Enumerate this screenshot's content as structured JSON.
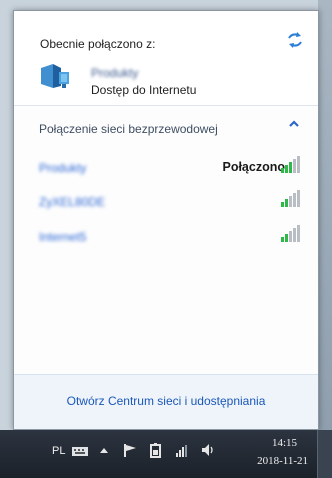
{
  "flyout": {
    "connected_title": "Obecnie połączono z:",
    "current_network": {
      "name": "Produkty",
      "access": "Dostęp do Internetu"
    },
    "wireless_header": "Połączenie sieci bezprzewodowej",
    "networks": [
      {
        "ssid": "Produkty",
        "status": "Połączono",
        "signal_bars": 5
      },
      {
        "ssid": "ZyXEL80DE",
        "status": "",
        "signal_bars": 5
      },
      {
        "ssid": "Internet5",
        "status": "",
        "signal_bars": 5
      }
    ],
    "footer_link": "Otwórz Centrum sieci i udostępniania"
  },
  "taskbar": {
    "language": "PL",
    "time": "14:15",
    "date": "2018-11-21"
  },
  "colors": {
    "signal_green": "#2fb84a",
    "signal_gray": "#b9bec4",
    "link_blue": "#1b57b8",
    "accent_blue": "#2b7fd6"
  },
  "icons": [
    "refresh-icon",
    "network-icon",
    "chevron-up-icon",
    "signal-icon",
    "keyboard-icon",
    "arrow-up-icon",
    "flag-icon",
    "battery-icon",
    "network-tray-icon",
    "speaker-icon"
  ]
}
